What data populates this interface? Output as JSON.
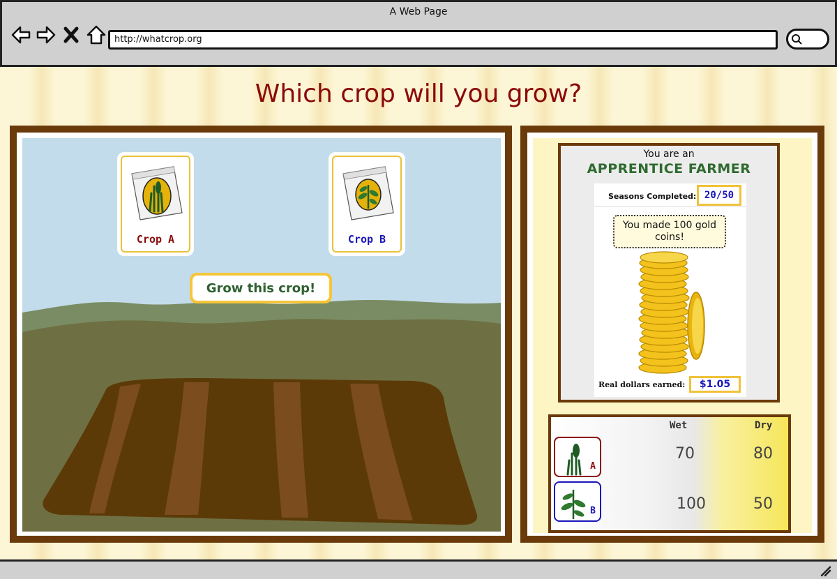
{
  "window": {
    "title": "A Web Page",
    "url": "http://whatcrop.org"
  },
  "page": {
    "headline": "Which crop will you grow?"
  },
  "game": {
    "crops": [
      {
        "label": "Crop A",
        "icon": "wheat-seed-packet-icon",
        "color": "#8b0a0a"
      },
      {
        "label": "Crop B",
        "icon": "leafy-seed-packet-icon",
        "color": "#1a17b8"
      }
    ],
    "grow_button": "Grow this crop!"
  },
  "status": {
    "line1": "You are an",
    "rank": "APPRENTICE FARMER",
    "seasons_label": "Seasons Completed:",
    "seasons_value": "20/50",
    "message": "You made 100 gold coins!",
    "dollars_label": "Real dollars earned:",
    "dollars_value": "$1.05"
  },
  "yield_table": {
    "columns": [
      "Wet",
      "Dry"
    ],
    "rows": [
      {
        "crop": "A",
        "wet": "70",
        "dry": "80"
      },
      {
        "crop": "B",
        "wet": "100",
        "dry": "50"
      }
    ]
  },
  "colors": {
    "frame_brown": "#6b3a0a",
    "headline_red": "#8b0a0a",
    "crop_a": "#8b0a0a",
    "crop_b": "#1a17b8",
    "gold": "#f0c23a",
    "rank_green": "#2f6a2f"
  }
}
